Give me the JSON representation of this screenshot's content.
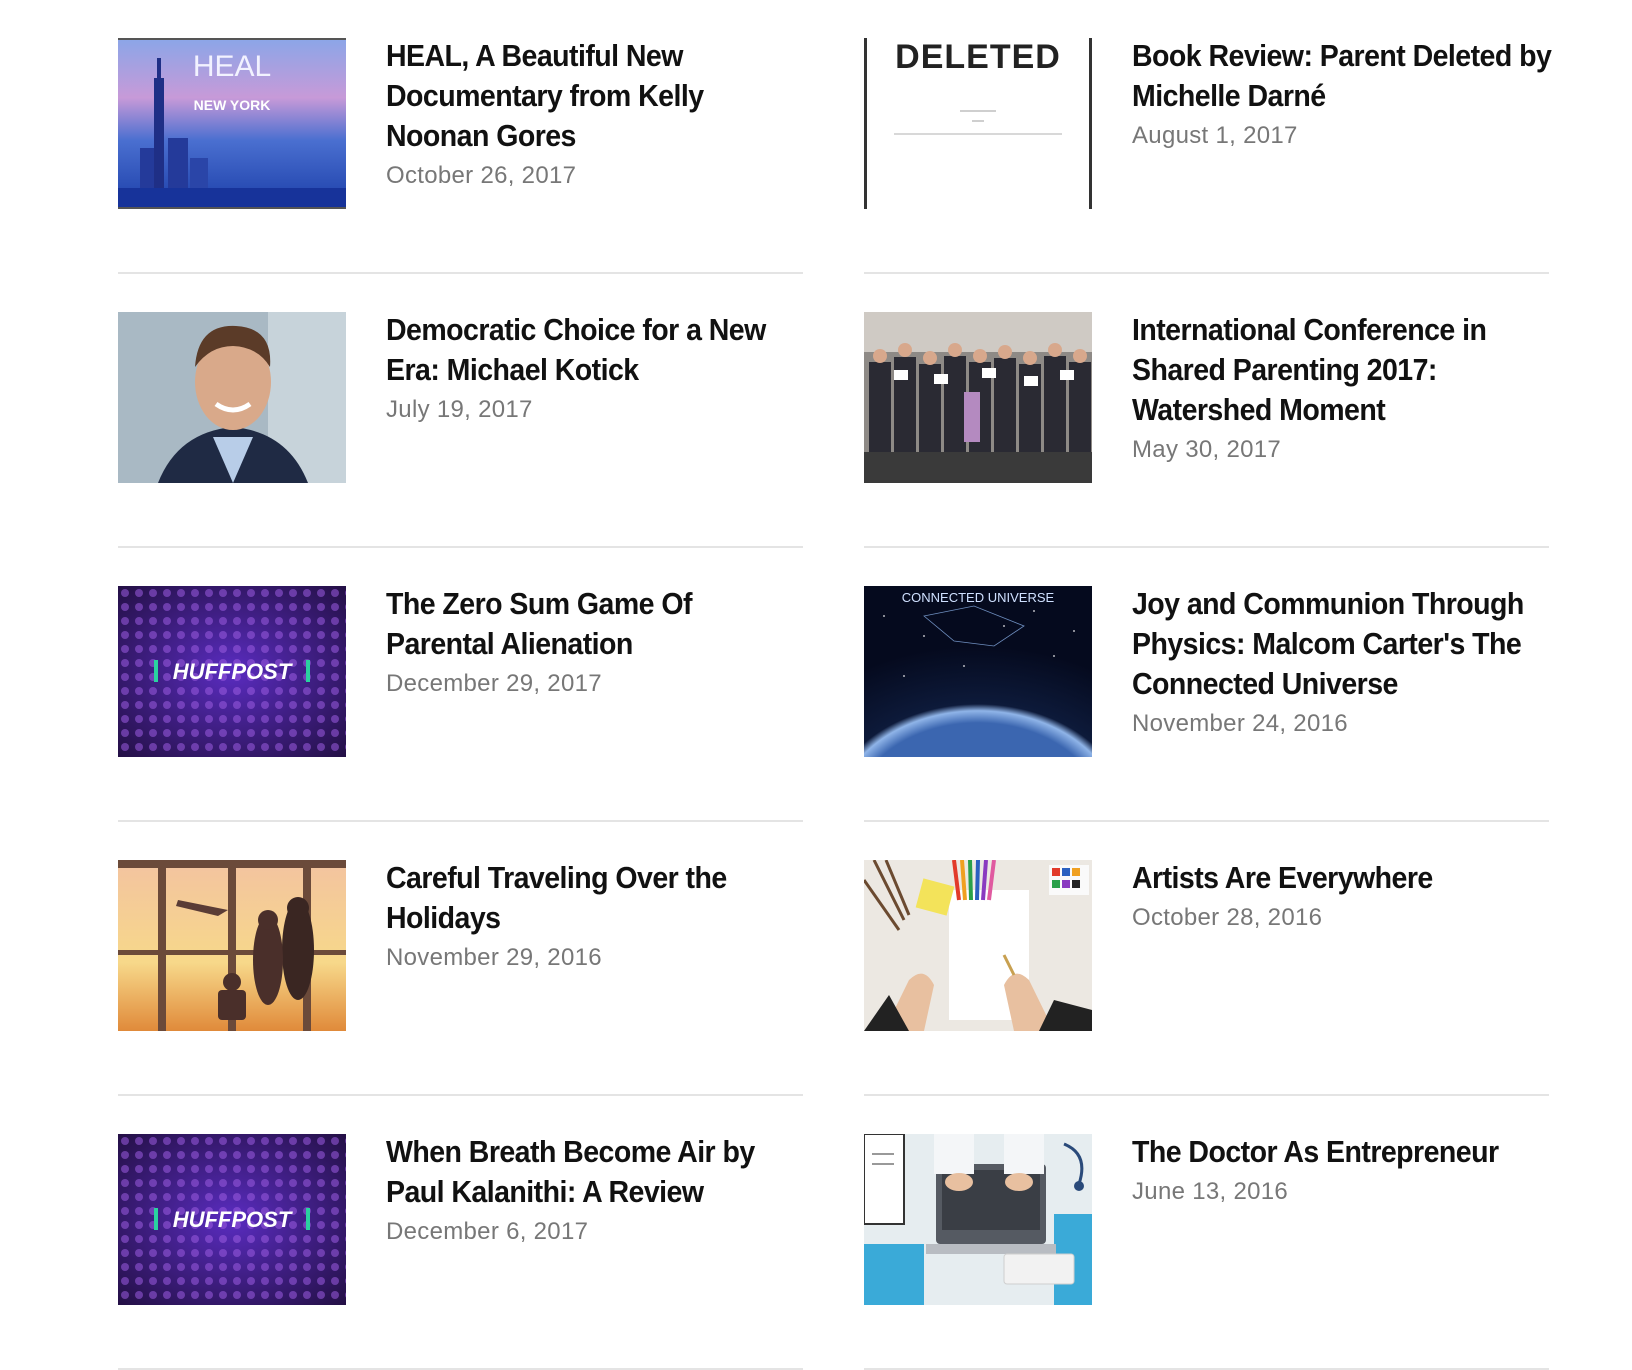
{
  "articles_left": [
    {
      "title": "HEAL, A Beautiful New Documentary from Kelly Noonan Gores",
      "date": "October 26, 2017",
      "thumb": {
        "icon": "heal-poster-image",
        "line1": "HEAL",
        "line2": "NEW YORK"
      }
    },
    {
      "title": "Democratic Choice for a New Era: Michael Kotick",
      "date": "July 19, 2017",
      "thumb": {
        "icon": "portrait-photo"
      }
    },
    {
      "title": "The Zero Sum Game Of Parental Alienation",
      "date": "December 29, 2017",
      "thumb": {
        "icon": "huffpost-logo-image",
        "line1": "HUFFPOST"
      }
    },
    {
      "title": "Careful Traveling Over the Holidays",
      "date": "November 29, 2016",
      "thumb": {
        "icon": "airport-family-photo"
      }
    },
    {
      "title": "When Breath Become Air by Paul Kalanithi: A Review",
      "date": "December 6, 2017",
      "thumb": {
        "icon": "huffpost-logo-image",
        "line1": "HUFFPOST"
      }
    }
  ],
  "articles_right": [
    {
      "title": "Book Review: Parent Deleted by Michelle Darné",
      "date": "August 1, 2017",
      "thumb": {
        "icon": "deleted-book-cover",
        "line1": "DELETED"
      }
    },
    {
      "title": "International Conference in Shared Parenting 2017: Watershed Moment",
      "date": "May 30, 2017",
      "thumb": {
        "icon": "conference-group-photo"
      }
    },
    {
      "title": "Joy and Communion Through Physics: Malcom Carter's The Connected Universe",
      "date": "November 24, 2016",
      "thumb": {
        "icon": "connected-universe-poster",
        "line1": "CONNECTED UNIVERSE"
      }
    },
    {
      "title": "Artists Are Everywhere",
      "date": "October 28, 2016",
      "thumb": {
        "icon": "artist-desk-photo"
      }
    },
    {
      "title": "The Doctor As Entrepreneur",
      "date": "June 13, 2016",
      "thumb": {
        "icon": "doctor-laptop-photo"
      }
    }
  ],
  "colors": {
    "divider": "#e4e4e4",
    "date_text": "#777777",
    "title_text": "#111111"
  }
}
